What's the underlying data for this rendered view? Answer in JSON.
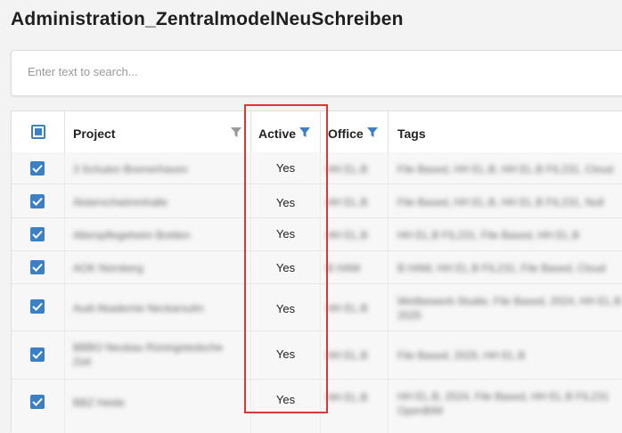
{
  "page": {
    "title": "Administration_ZentralmodelNeuSchreiben"
  },
  "search": {
    "placeholder": "Enter text to search..."
  },
  "table": {
    "columns": [
      {
        "key": "select",
        "label": ""
      },
      {
        "key": "project",
        "label": "Project",
        "filter_icon": "filter-icon",
        "filter_active": false
      },
      {
        "key": "active",
        "label": "Active",
        "filter_icon": "filter-icon",
        "filter_active": true
      },
      {
        "key": "office",
        "label": "Office",
        "filter_icon": "filter-icon",
        "filter_active": true
      },
      {
        "key": "tags",
        "label": "Tags"
      }
    ],
    "rows": [
      {
        "checked": true,
        "project": "3 Schulen Bremerhaven",
        "active": "Yes",
        "office": "HH EL.B",
        "tags": [
          "File Based, HH EL.B, HH EL.B FIL231, Cloud"
        ]
      },
      {
        "checked": true,
        "project": "Alsterschwimmhalle",
        "active": "Yes",
        "office": "HH EL.B",
        "tags": [
          "File Based, HH EL.B, HH EL.B FIL231, Null"
        ]
      },
      {
        "checked": true,
        "project": "Alterspflegeheim Bretten",
        "active": "Yes",
        "office": "HH EL.B",
        "tags": [
          "HH EL.B FIL231, File Based, HH EL.B"
        ]
      },
      {
        "checked": true,
        "project": "AOK Nürnberg",
        "active": "Yes",
        "office": "B HAM",
        "tags": [
          "B HAM, HH EL.B FIL231, File Based, Cloud"
        ]
      },
      {
        "checked": true,
        "project": "Audi Akademie Neckarsulm",
        "active": "Yes",
        "office": "HH EL.B",
        "tags": [
          "Wettbewerb Studie, File Based, 2024, HH EL.B",
          "2025"
        ]
      },
      {
        "checked": true,
        "project": "BBBO Neubau Rüningstedsche",
        "project2": "Zeit",
        "active": "Yes",
        "office": "HH EL.B",
        "tags": [
          "File Based, 2025, HH EL.B"
        ]
      },
      {
        "checked": true,
        "project": "BBZ Heide",
        "active": "Yes",
        "office": "HH EL.B",
        "tags": [
          "HH EL.B, 2024, File Based, HH EL.B FIL231",
          "OpenBIM"
        ]
      }
    ]
  },
  "colors": {
    "accent": "#3b7fc4",
    "highlight": "#d63a34",
    "filter_inactive": "#9a9a9a",
    "filter_active": "#3b7fc4"
  }
}
